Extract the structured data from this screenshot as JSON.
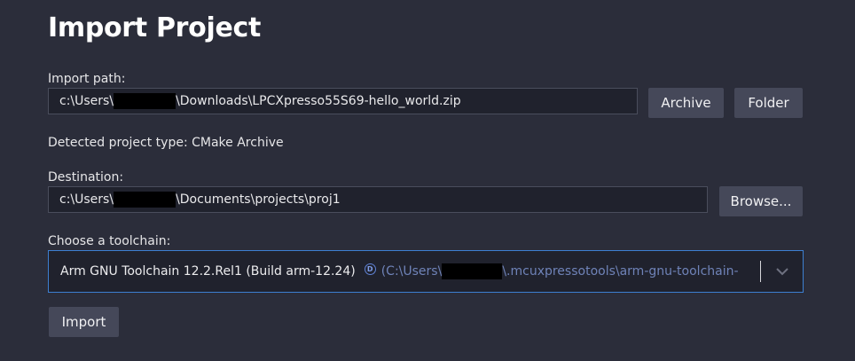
{
  "page": {
    "title": "Import Project"
  },
  "import_path": {
    "label": "Import path:",
    "value_prefix": "c:\\Users\\",
    "value_suffix": "\\Downloads\\LPCXpresso55S69-hello_world.zip"
  },
  "buttons": {
    "archive": "Archive",
    "folder": "Folder",
    "browse": "Browse...",
    "import": "Import"
  },
  "detected": {
    "text": "Detected project type: CMake Archive"
  },
  "destination": {
    "label": "Destination:",
    "value_prefix": "c:\\Users\\",
    "value_suffix": "\\Documents\\projects\\proj1"
  },
  "toolchain": {
    "label": "Choose a toolchain:",
    "selected": "Arm GNU Toolchain 12.2.Rel1 (Build arm-12.24)",
    "badge": "D",
    "path_prefix": "(C:\\Users\\",
    "path_suffix": "\\.mcuxpressotools\\arm-gnu-toolchain-",
    "chevron_icon": "chevron-down-icon"
  },
  "colors": {
    "background": "#2b2d3a",
    "field": "#20222d",
    "button": "#454859",
    "focus_border": "#3d7fd1"
  }
}
